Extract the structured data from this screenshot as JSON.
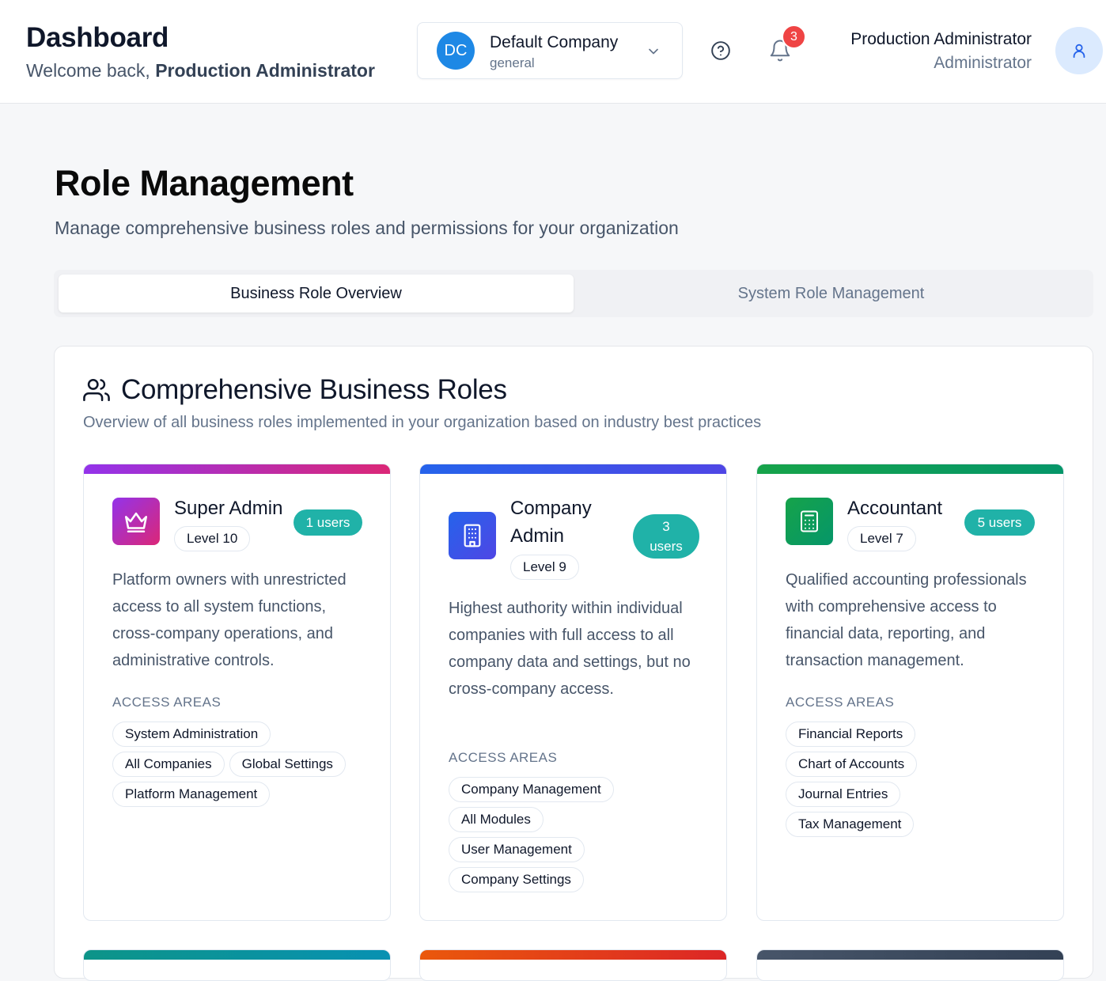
{
  "header": {
    "title": "Dashboard",
    "welcome_prefix": "Welcome back, ",
    "welcome_name": "Production Administrator",
    "company": {
      "initials": "DC",
      "name": "Default Company",
      "sub": "general"
    },
    "notifications_count": "3",
    "user": {
      "name": "Production Administrator",
      "role": "Administrator"
    }
  },
  "page": {
    "title": "Role Management",
    "subtitle": "Manage comprehensive business roles and permissions for your organization",
    "tabs": [
      {
        "label": "Business Role Overview",
        "active": true
      },
      {
        "label": "System Role Management",
        "active": false
      }
    ]
  },
  "section": {
    "title": "Comprehensive Business Roles",
    "subtitle": "Overview of all business roles implemented in your organization based on industry best practices"
  },
  "access_label": "ACCESS AREAS",
  "roles": [
    {
      "name": "Super Admin",
      "level": "Level 10",
      "users": "1 users",
      "description": "Platform owners with unrestricted access to all system functions, cross-company operations, and administrative controls.",
      "access": [
        "System Administration",
        "All Companies",
        "Global Settings",
        "Platform Management"
      ],
      "icon": "crown-icon",
      "colors": [
        "#9333ea",
        "#db2777"
      ]
    },
    {
      "name": "Company Admin",
      "level": "Level 9",
      "users": "3 users",
      "description": "Highest authority within individual companies with full access to all company data and settings, but no cross-company access.",
      "access": [
        "Company Management",
        "All Modules",
        "User Management",
        "Company Settings"
      ],
      "icon": "building-icon",
      "colors": [
        "#2563eb",
        "#4f46e5"
      ]
    },
    {
      "name": "Accountant",
      "level": "Level 7",
      "users": "5 users",
      "description": "Qualified accounting professionals with comprehensive access to financial data, reporting, and transaction management.",
      "access": [
        "Financial Reports",
        "Chart of Accounts",
        "Journal Entries",
        "Tax Management"
      ],
      "icon": "calculator-icon",
      "colors": [
        "#16a34a",
        "#059669"
      ]
    }
  ],
  "stub_colors": [
    [
      "#0d9488",
      "#0891b2"
    ],
    [
      "#ea580c",
      "#dc2626"
    ],
    [
      "#475569",
      "#334155"
    ]
  ]
}
